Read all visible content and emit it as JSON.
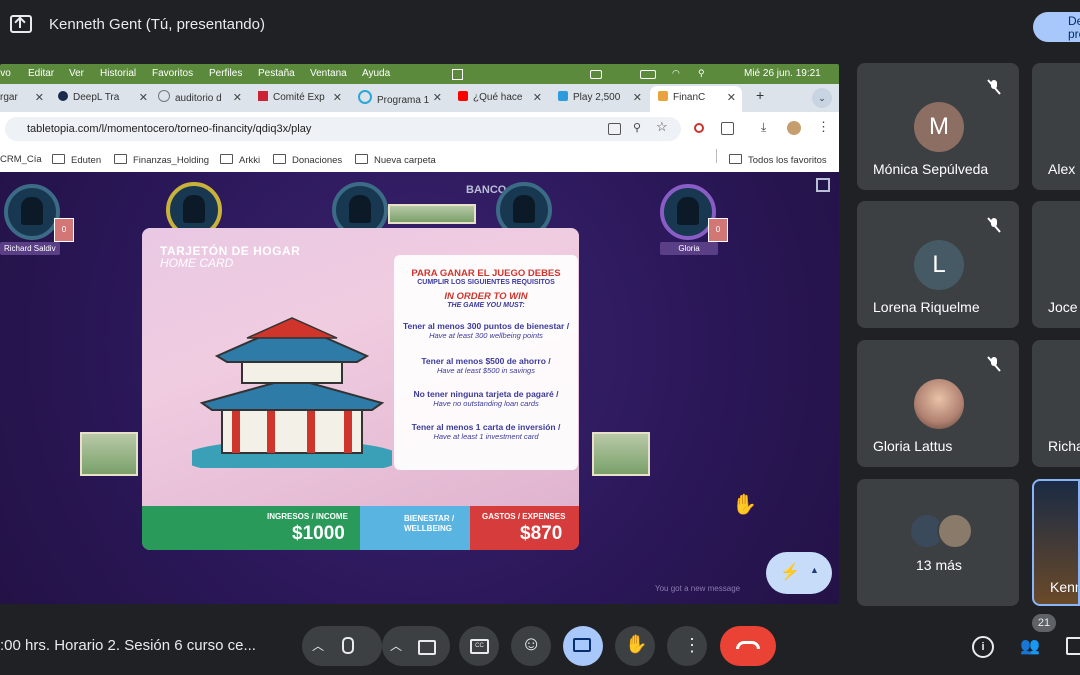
{
  "header": {
    "title": "Kenneth Gent (Tú, presentando)",
    "stop_label": "Deja de presentar"
  },
  "mac_menu": {
    "items": [
      "ivo",
      "Editar",
      "Ver",
      "Historial",
      "Favoritos",
      "Perfiles",
      "Pestaña",
      "Ventana",
      "Ayuda"
    ],
    "clock": "Mié 26 jun.  19:21"
  },
  "browser": {
    "tabs": [
      "rgar",
      "DeepL Tra",
      "auditorio d",
      "Comité Exp",
      "Programa 1",
      "¿Qué hace",
      "Play 2,500",
      "FinanC"
    ],
    "url": "tabletopia.com/l/momentocero/torneo-financity/qdiq3x/play",
    "bookmarks": [
      "CRM_Cía",
      "Eduten",
      "Finanzas_Holding",
      "Arkki",
      "Donaciones",
      "Nueva carpeta"
    ],
    "all_bookmarks": "Todos los favoritos"
  },
  "game": {
    "players": [
      {
        "name": "Richard Saldiv",
        "count": "0"
      },
      {
        "name": "Gloria",
        "count": "0"
      }
    ],
    "bank_label": "BANCO",
    "card": {
      "title": "TARJETÓN DE HOGAR",
      "subtitle": "HOME CARD",
      "rules_heading": "PARA GANAR EL JUEGO DEBES",
      "rules_sub": "CUMPLIR LOS SIGUIENTES REQUISITOS",
      "rules_heading_en": "IN ORDER TO WIN",
      "rules_sub_en": "THE GAME YOU MUST:",
      "rules": [
        {
          "es": "Tener al menos 300 puntos de bienestar /",
          "en": "Have at least 300 wellbeing points"
        },
        {
          "es": "Tener al menos $500 de ahorro /",
          "en": "Have at least $500 in savings"
        },
        {
          "es": "No tener ninguna tarjeta de pagaré /",
          "en": "Have no outstanding loan cards"
        },
        {
          "es": "Tener al menos 1 carta de inversión /",
          "en": "Have at least 1 investment card"
        }
      ],
      "income_label": "INGRESOS / INCOME",
      "income_value": "$1000",
      "wellbeing_label1": "BIENESTAR /",
      "wellbeing_label2": "WELLBEING",
      "expenses_label": "GASTOS / EXPENSES",
      "expenses_value": "$870"
    },
    "message_hint": "You got a new message"
  },
  "participants": [
    {
      "name": "Mónica Sepúlveda",
      "initial": "M",
      "color": "#8d6e63"
    },
    {
      "name": "Lorena Riquelme",
      "initial": "L",
      "color": "#455a64"
    },
    {
      "name": "Gloria Lattus",
      "initial": "",
      "color": "#b08070"
    },
    {
      "name": "13 más",
      "initial": "",
      "color": ""
    }
  ],
  "participants_partial": [
    "Alex",
    "Joce",
    "Richa",
    "Kenn"
  ],
  "bottom": {
    "meeting_name": ":00 hrs. Horario 2. Sesión 6 curso ce...",
    "participant_count": "21"
  }
}
